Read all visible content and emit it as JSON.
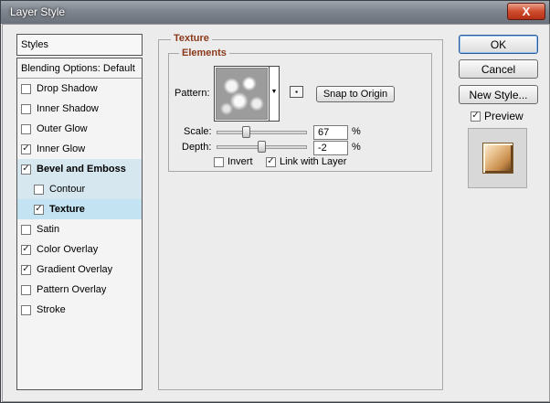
{
  "window": {
    "title": "Layer Style",
    "close_glyph": "X"
  },
  "styles_panel": {
    "header": "Styles",
    "blending_options": "Blending Options: Default",
    "items": [
      {
        "label": "Drop Shadow",
        "checked": false
      },
      {
        "label": "Inner Shadow",
        "checked": false
      },
      {
        "label": "Outer Glow",
        "checked": false
      },
      {
        "label": "Inner Glow",
        "checked": true
      },
      {
        "label": "Bevel and Emboss",
        "checked": true
      },
      {
        "label": "Contour",
        "checked": false
      },
      {
        "label": "Texture",
        "checked": true
      },
      {
        "label": "Satin",
        "checked": false
      },
      {
        "label": "Color Overlay",
        "checked": true
      },
      {
        "label": "Gradient Overlay",
        "checked": true
      },
      {
        "label": "Pattern Overlay",
        "checked": false
      },
      {
        "label": "Stroke",
        "checked": false
      }
    ]
  },
  "texture": {
    "group_title": "Texture",
    "elements_title": "Elements",
    "pattern_label": "Pattern:",
    "snap_button": "Snap to Origin",
    "scale_label": "Scale:",
    "scale_value": "67",
    "depth_label": "Depth:",
    "depth_value": "-2",
    "percent": "%",
    "invert_label": "Invert",
    "invert_checked": false,
    "link_label": "Link with Layer",
    "link_checked": true
  },
  "actions": {
    "ok": "OK",
    "cancel": "Cancel",
    "new_style": "New Style...",
    "preview_label": "Preview",
    "preview_checked": true
  },
  "check_glyph": "✓"
}
